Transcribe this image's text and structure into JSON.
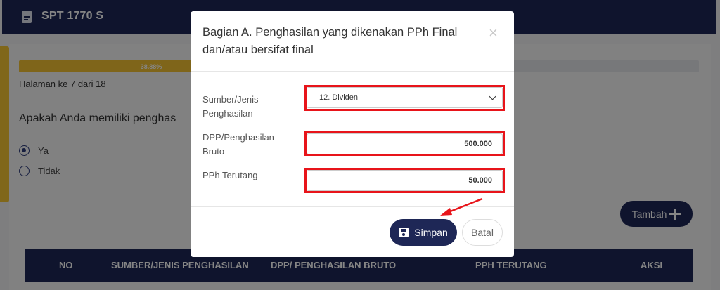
{
  "header": {
    "title": "SPT 1770 S",
    "icon": "document-icon"
  },
  "progress": {
    "percent_label": "38.88%",
    "value": 0.3888
  },
  "page_indicator": "Halaman ke 7 dari 18",
  "question": "Apakah Anda memiliki penghas",
  "options": [
    {
      "label": "Ya",
      "selected": true
    },
    {
      "label": "Tidak",
      "selected": false
    }
  ],
  "add_button": {
    "label": "Tambah"
  },
  "table": {
    "headers": [
      "NO",
      "SUMBER/JENIS PENGHASILAN",
      "DPP/ PENGHASILAN BRUTO",
      "PPH TERUTANG",
      "AKSI"
    ]
  },
  "modal": {
    "title": "Bagian A. Penghasilan yang dikenakan PPh Final dan/atau bersifat final",
    "close_glyph": "×",
    "fields": {
      "source_label": "Sumber/Jenis Penghasilan",
      "source_value": "12. Dividen",
      "dpp_label": "DPP/Penghasilan Bruto",
      "dpp_value": "500.000",
      "pph_label": "PPh Terutang",
      "pph_value": "50.000"
    },
    "save_label": "Simpan",
    "cancel_label": "Batal"
  },
  "colors": {
    "navy": "#1e2756",
    "accent_yellow": "#f3c232",
    "highlight_red": "#e8141a"
  }
}
